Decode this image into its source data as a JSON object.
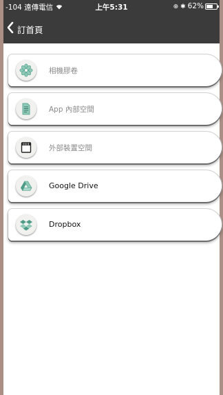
{
  "status_bar": {
    "carrier": "-104 遠傳電信",
    "time": "上午5:31",
    "battery": "62%",
    "battery_level": 0.62,
    "wifi_icon": "wifi-icon",
    "bluetooth_icon": "bluetooth-icon",
    "location_icon": "location-icon"
  },
  "nav": {
    "back_label": "訂首頁",
    "back_icon": "chevron-left-icon"
  },
  "items": [
    {
      "label": "相機膠卷",
      "icon": "camera-roll-icon",
      "active": false
    },
    {
      "label": "App 內部空間",
      "icon": "document-icon",
      "active": false
    },
    {
      "label": "外部裝置空間",
      "icon": "sd-card-icon",
      "active": false
    },
    {
      "label": "Google Drive",
      "icon": "google-drive-icon",
      "active": true
    },
    {
      "label": "Dropbox",
      "icon": "dropbox-icon",
      "active": true
    }
  ],
  "colors": {
    "bar_background": "#3b3b3b",
    "icon_teal": "#8ec9b8",
    "icon_teal_dark": "#4d9c87",
    "frame": "#a98f85"
  }
}
